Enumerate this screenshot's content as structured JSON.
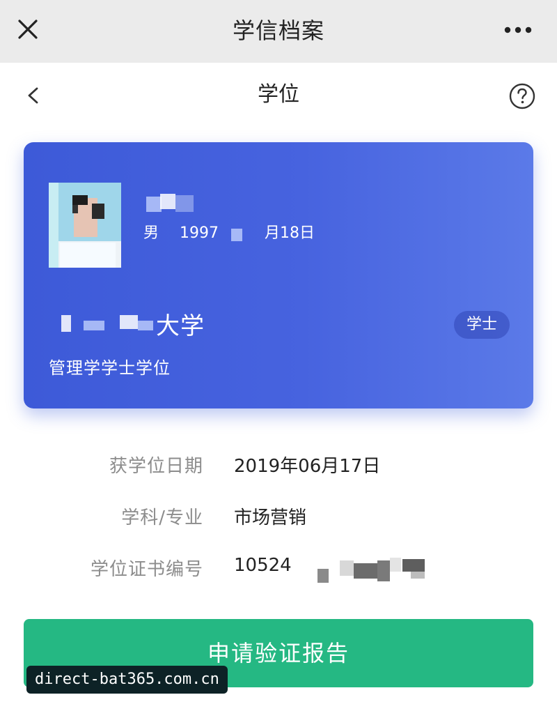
{
  "topbar": {
    "title": "学信档案"
  },
  "header": {
    "title": "学位"
  },
  "card": {
    "gender": "男",
    "birth_prefix": "1997",
    "birth_suffix": "月18日",
    "university_suffix": "大学",
    "degree_name": "管理学学士学位",
    "badge": "学士",
    "colors": {
      "card_start": "#3d5ad8",
      "card_end": "#5b7ae8"
    }
  },
  "details": [
    {
      "label": "获学位日期",
      "value": "2019年06月17日"
    },
    {
      "label": "学科/专业",
      "value": "市场营销"
    },
    {
      "label": "学位证书编号",
      "value": "10524"
    }
  ],
  "button": {
    "label": "申请验证报告",
    "color": "#25b883"
  },
  "watermark": {
    "text": "direct-bat365.com.cn"
  },
  "icons": [
    "close-icon",
    "more-icon",
    "back-icon",
    "help-icon"
  ]
}
